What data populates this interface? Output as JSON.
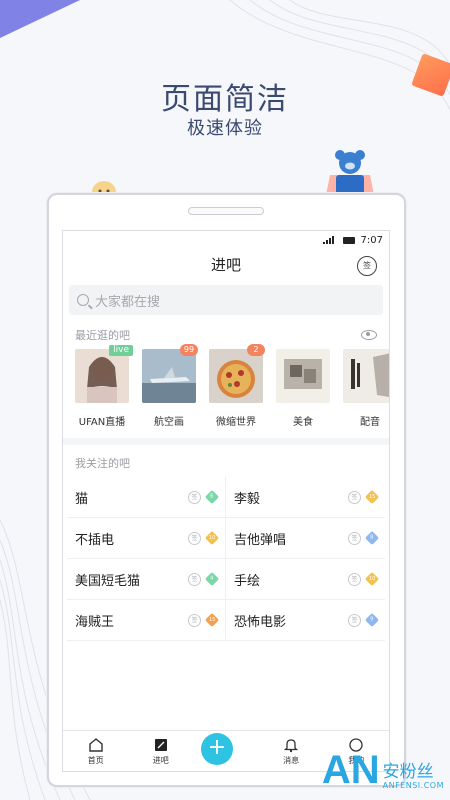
{
  "promo": {
    "title": "页面简洁",
    "subtitle": "极速体验"
  },
  "status_bar": {
    "time": "7:07"
  },
  "header": {
    "title": "进吧",
    "sign_in_label": "签"
  },
  "search": {
    "placeholder": "大家都在搜"
  },
  "recent": {
    "label": "最近逛的吧",
    "items": [
      {
        "name": "UFAN直播",
        "badge": "live"
      },
      {
        "name": "航空画",
        "badge": "99"
      },
      {
        "name": "微缩世界",
        "badge": "2"
      },
      {
        "name": "美食",
        "badge": ""
      },
      {
        "name": "配音",
        "badge": ""
      }
    ]
  },
  "followed": {
    "label": "我关注的吧",
    "items": [
      {
        "name": "猫",
        "level": "6",
        "level_color": "#7ad7a6"
      },
      {
        "name": "李毅",
        "level": "15",
        "level_color": "#f2c14e"
      },
      {
        "name": "不插电",
        "level": "10",
        "level_color": "#f2c14e"
      },
      {
        "name": "吉他弹唱",
        "level": "8",
        "level_color": "#8fb8ef"
      },
      {
        "name": "美国短毛猫",
        "level": "4",
        "level_color": "#7ad7a6"
      },
      {
        "name": "手绘",
        "level": "10",
        "level_color": "#f2c14e"
      },
      {
        "name": "海贼王",
        "level": "15",
        "level_color": "#f2a04e"
      },
      {
        "name": "恐怖电影",
        "level": "9",
        "level_color": "#8fb8ef"
      }
    ],
    "sign_mark": "签"
  },
  "tabbar": {
    "home": "首页",
    "forum": "进吧",
    "messages": "消息",
    "me": "我的"
  },
  "watermark": {
    "logo": "AN",
    "cn": "安粉丝",
    "en": "ANFENSI.COM"
  },
  "colors": {
    "accent": "#2fc3e3",
    "live": "#6fcf97",
    "badge": "#f4845f",
    "headline": "#3b4a70"
  }
}
